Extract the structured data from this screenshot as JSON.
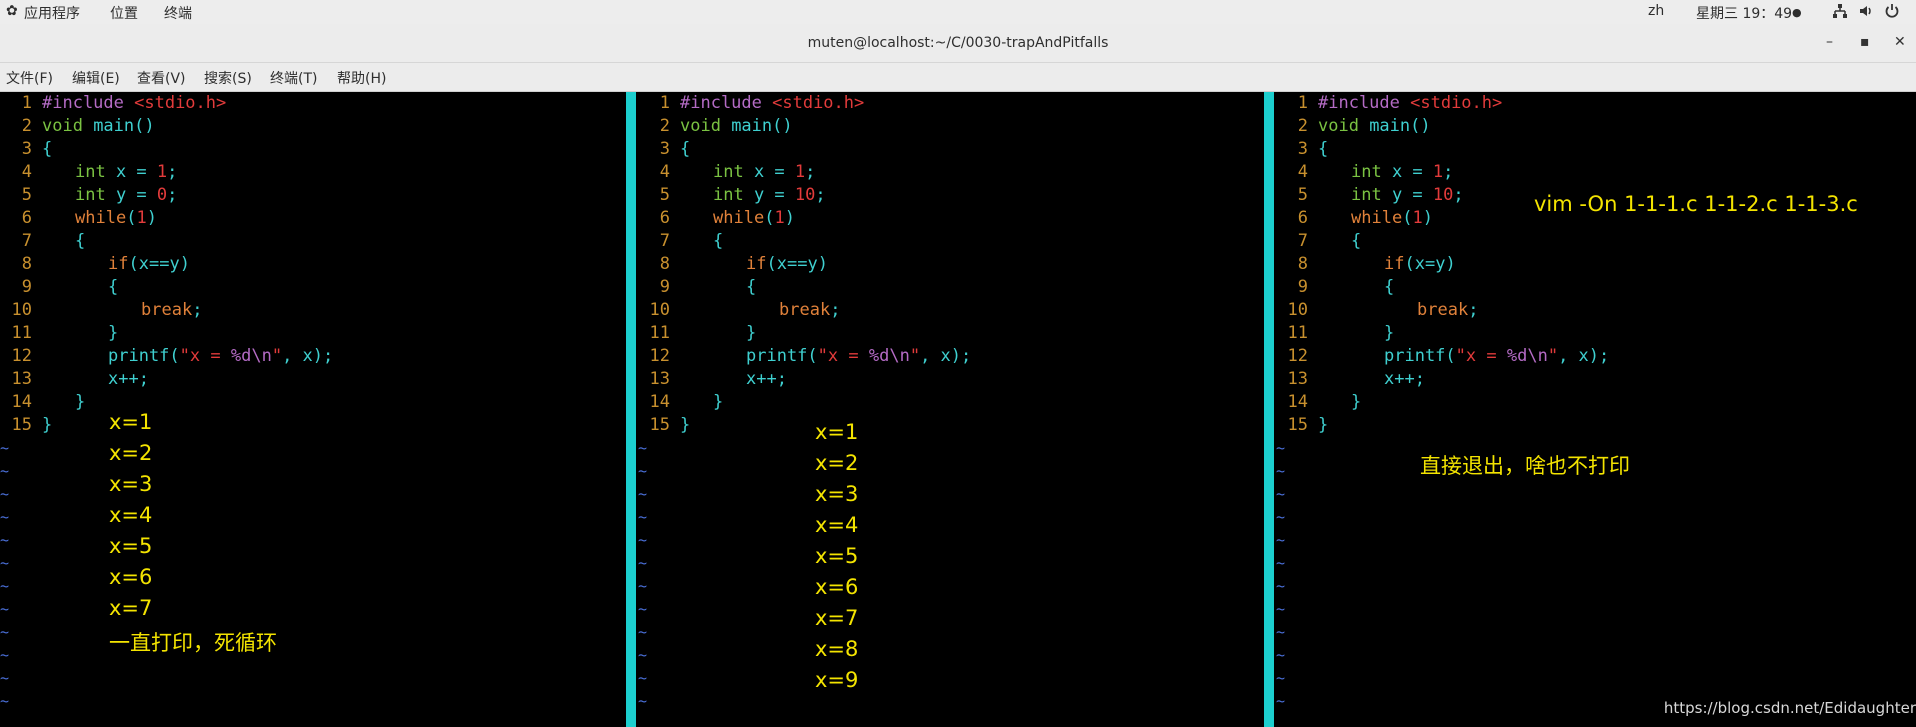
{
  "topbar": {
    "apps_label": "应用程序",
    "places_label": "位置",
    "terminal_label": "终端",
    "lang": "zh",
    "clock": "星期三 19：49",
    "clock_dot": "●"
  },
  "window": {
    "title": "muten@localhost:~/C/0030-trapAndPitfalls",
    "minimize": "–",
    "maximize": "▪",
    "close": "✕"
  },
  "menu": [
    "文件(F)",
    "编辑(E)",
    "查看(V)",
    "搜索(S)",
    "终端(T)",
    "帮助(H)"
  ],
  "code_common": {
    "l1a": "#include ",
    "l1b": "<stdio.h>",
    "l2a": "void ",
    "l2b": "main",
    "paren_open": "(",
    "paren_close": ")",
    "paren_pair": "()",
    "brace_open": "{",
    "brace_close": "}",
    "kw_int": "int",
    "x_eq": " x = ",
    "y_eq": " y = ",
    "semi": ";",
    "kw_while": "while",
    "one": "1",
    "kw_if": "if",
    "kw_break": "break",
    "kw_printf": "printf",
    "q": "\"",
    "fmt_a": "x = ",
    "fmt_b": "%d\\n",
    "printf_tail": ", x);",
    "xpp": "x++;"
  },
  "panes": [
    {
      "y_value": "0",
      "condition": "x==y",
      "output": [
        "x=1",
        "x=2",
        "x=3",
        "x=4",
        "x=5",
        "x=6",
        "x=7"
      ],
      "note": "一直打印，死循环"
    },
    {
      "y_value": "10",
      "condition": "x==y",
      "output": [
        "x=1",
        "x=2",
        "x=3",
        "x=4",
        "x=5",
        "x=6",
        "x=7",
        "x=8",
        "x=9"
      ]
    },
    {
      "y_value": "10",
      "condition": "x=y",
      "command": "vim -On 1-1-1.c 1-1-2.c 1-1-3.c",
      "note": "直接退出，啥也不打印"
    }
  ],
  "line_numbers": [
    "1",
    "2",
    "3",
    "4",
    "5",
    "6",
    "7",
    "8",
    "9",
    "10",
    "11",
    "12",
    "13",
    "14",
    "15"
  ],
  "tilde": "~",
  "watermark": "https://blog.csdn.net/Edidaughter"
}
